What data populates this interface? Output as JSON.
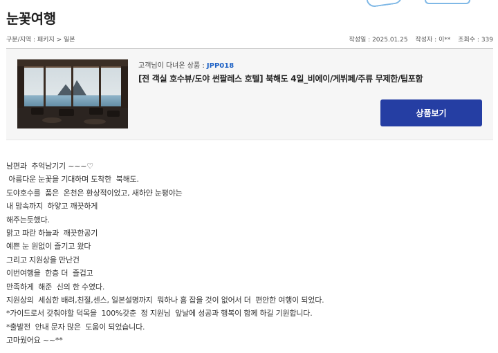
{
  "page": {
    "title": "눈꽃여행"
  },
  "meta": {
    "breadcrumb": "구분/지역 : 패키지 > 일본",
    "date": "작성일 : 2025.01.25",
    "author": "작성자 : 이**",
    "views": "조회수 : 339"
  },
  "product": {
    "label_prefix": "고객님이 다녀온 상품 :",
    "code": "JPP018",
    "name": "[전 객실 호수뷰/도야 썬팔레스 호텔] 북해도 4일_비에이/게뷔페/주류 무제한/팁포함",
    "button_label": "상품보기",
    "image_desc": "lake-view-lounge-photo"
  },
  "review": {
    "lines": [
      "남편과  추억남기기 ~~~♡",
      " 아름다운 눈꽃을 기대하며 도착한  북해도.",
      "도야호수를  품은  온천은 환상적이었고, 새하얀 눈평야는",
      "내 맘속까지  하얗고 깨끗하게",
      "해주는듯했다.",
      "맑고 파란 하늘과  깨끗한공기",
      "예쁜 눈 원없이 즐기고 왔다",
      "그리고 지원상을 만난건",
      "이번여행을  한층 더  즐겁고",
      "만족하게  해준  신의 한 수였다.",
      "지원상의  세심한 배려,친절,센스, 일본설명까지  뭐하나 흠 잡을 것이 없어서 더  편안한 여행이 되었다.",
      "*가이드로서 갖춰야할 덕목을  100%갖춘  정 지원님  앞날에 성공과 행복이 함께 하길 기원합니다.",
      "*출발전  안내 문자 많은  도움이 되었습니다.",
      "고마웠어요 ~~**"
    ]
  },
  "colors": {
    "button_bg": "#253ea3",
    "code_color": "#1a5fc4",
    "box_bg": "#f6f6f6"
  }
}
